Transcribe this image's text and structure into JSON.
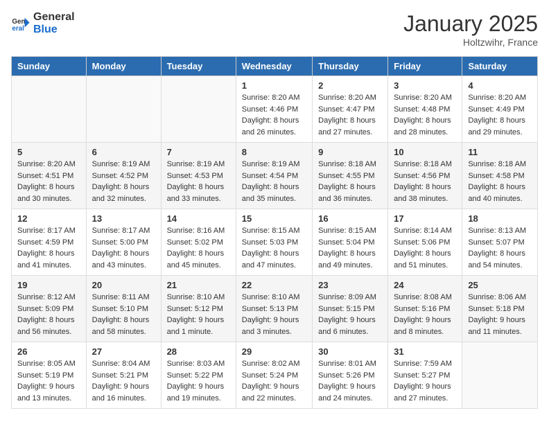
{
  "logo": {
    "general": "General",
    "blue": "Blue"
  },
  "title": "January 2025",
  "location": "Holtzwihr, France",
  "weekdays": [
    "Sunday",
    "Monday",
    "Tuesday",
    "Wednesday",
    "Thursday",
    "Friday",
    "Saturday"
  ],
  "weeks": [
    [
      {
        "day": "",
        "empty": true
      },
      {
        "day": "",
        "empty": true
      },
      {
        "day": "",
        "empty": true
      },
      {
        "day": "1",
        "sunrise": "8:20 AM",
        "sunset": "4:46 PM",
        "daylight": "8 hours and 26 minutes."
      },
      {
        "day": "2",
        "sunrise": "8:20 AM",
        "sunset": "4:47 PM",
        "daylight": "8 hours and 27 minutes."
      },
      {
        "day": "3",
        "sunrise": "8:20 AM",
        "sunset": "4:48 PM",
        "daylight": "8 hours and 28 minutes."
      },
      {
        "day": "4",
        "sunrise": "8:20 AM",
        "sunset": "4:49 PM",
        "daylight": "8 hours and 29 minutes."
      }
    ],
    [
      {
        "day": "5",
        "sunrise": "8:20 AM",
        "sunset": "4:51 PM",
        "daylight": "8 hours and 30 minutes."
      },
      {
        "day": "6",
        "sunrise": "8:19 AM",
        "sunset": "4:52 PM",
        "daylight": "8 hours and 32 minutes."
      },
      {
        "day": "7",
        "sunrise": "8:19 AM",
        "sunset": "4:53 PM",
        "daylight": "8 hours and 33 minutes."
      },
      {
        "day": "8",
        "sunrise": "8:19 AM",
        "sunset": "4:54 PM",
        "daylight": "8 hours and 35 minutes."
      },
      {
        "day": "9",
        "sunrise": "8:18 AM",
        "sunset": "4:55 PM",
        "daylight": "8 hours and 36 minutes."
      },
      {
        "day": "10",
        "sunrise": "8:18 AM",
        "sunset": "4:56 PM",
        "daylight": "8 hours and 38 minutes."
      },
      {
        "day": "11",
        "sunrise": "8:18 AM",
        "sunset": "4:58 PM",
        "daylight": "8 hours and 40 minutes."
      }
    ],
    [
      {
        "day": "12",
        "sunrise": "8:17 AM",
        "sunset": "4:59 PM",
        "daylight": "8 hours and 41 minutes."
      },
      {
        "day": "13",
        "sunrise": "8:17 AM",
        "sunset": "5:00 PM",
        "daylight": "8 hours and 43 minutes."
      },
      {
        "day": "14",
        "sunrise": "8:16 AM",
        "sunset": "5:02 PM",
        "daylight": "8 hours and 45 minutes."
      },
      {
        "day": "15",
        "sunrise": "8:15 AM",
        "sunset": "5:03 PM",
        "daylight": "8 hours and 47 minutes."
      },
      {
        "day": "16",
        "sunrise": "8:15 AM",
        "sunset": "5:04 PM",
        "daylight": "8 hours and 49 minutes."
      },
      {
        "day": "17",
        "sunrise": "8:14 AM",
        "sunset": "5:06 PM",
        "daylight": "8 hours and 51 minutes."
      },
      {
        "day": "18",
        "sunrise": "8:13 AM",
        "sunset": "5:07 PM",
        "daylight": "8 hours and 54 minutes."
      }
    ],
    [
      {
        "day": "19",
        "sunrise": "8:12 AM",
        "sunset": "5:09 PM",
        "daylight": "8 hours and 56 minutes."
      },
      {
        "day": "20",
        "sunrise": "8:11 AM",
        "sunset": "5:10 PM",
        "daylight": "8 hours and 58 minutes."
      },
      {
        "day": "21",
        "sunrise": "8:10 AM",
        "sunset": "5:12 PM",
        "daylight": "9 hours and 1 minute."
      },
      {
        "day": "22",
        "sunrise": "8:10 AM",
        "sunset": "5:13 PM",
        "daylight": "9 hours and 3 minutes."
      },
      {
        "day": "23",
        "sunrise": "8:09 AM",
        "sunset": "5:15 PM",
        "daylight": "9 hours and 6 minutes."
      },
      {
        "day": "24",
        "sunrise": "8:08 AM",
        "sunset": "5:16 PM",
        "daylight": "9 hours and 8 minutes."
      },
      {
        "day": "25",
        "sunrise": "8:06 AM",
        "sunset": "5:18 PM",
        "daylight": "9 hours and 11 minutes."
      }
    ],
    [
      {
        "day": "26",
        "sunrise": "8:05 AM",
        "sunset": "5:19 PM",
        "daylight": "9 hours and 13 minutes."
      },
      {
        "day": "27",
        "sunrise": "8:04 AM",
        "sunset": "5:21 PM",
        "daylight": "9 hours and 16 minutes."
      },
      {
        "day": "28",
        "sunrise": "8:03 AM",
        "sunset": "5:22 PM",
        "daylight": "9 hours and 19 minutes."
      },
      {
        "day": "29",
        "sunrise": "8:02 AM",
        "sunset": "5:24 PM",
        "daylight": "9 hours and 22 minutes."
      },
      {
        "day": "30",
        "sunrise": "8:01 AM",
        "sunset": "5:26 PM",
        "daylight": "9 hours and 24 minutes."
      },
      {
        "day": "31",
        "sunrise": "7:59 AM",
        "sunset": "5:27 PM",
        "daylight": "9 hours and 27 minutes."
      },
      {
        "day": "",
        "empty": true
      }
    ]
  ]
}
